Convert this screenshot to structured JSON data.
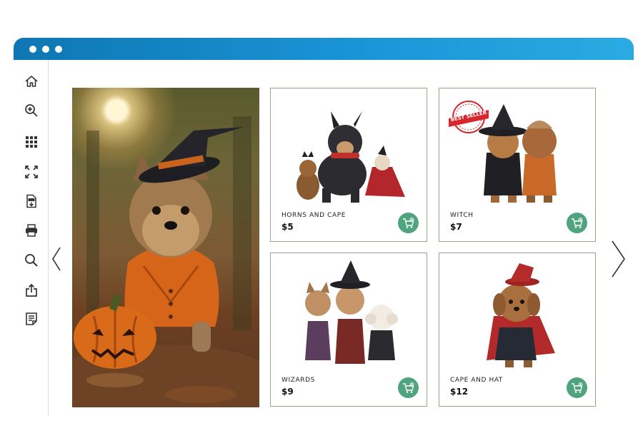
{
  "window": {
    "title_bar_color": "#1a94d6"
  },
  "sidebar": {
    "icons": [
      {
        "name": "home-icon"
      },
      {
        "name": "zoom-in-icon"
      },
      {
        "name": "grid-icon"
      },
      {
        "name": "fullscreen-icon"
      },
      {
        "name": "pdf-download-icon"
      },
      {
        "name": "print-icon"
      },
      {
        "name": "search-icon"
      },
      {
        "name": "share-icon"
      },
      {
        "name": "notes-icon"
      }
    ]
  },
  "navigation": {
    "prev": "prev-arrow-icon",
    "next": "next-arrow-icon"
  },
  "products": [
    {
      "name": "HORNS AND CAPE",
      "price": "$5",
      "best_seller": false
    },
    {
      "name": "WITCH",
      "price": "$7",
      "best_seller": true
    },
    {
      "name": "WIZARDS",
      "price": "$9",
      "best_seller": false
    },
    {
      "name": "CAPE AND HAT",
      "price": "$12",
      "best_seller": false
    }
  ],
  "badge": {
    "text": "BEST SELLER",
    "color": "#d7262d"
  },
  "colors": {
    "cart_button": "#4fa37e",
    "card_border": "#9aa382"
  }
}
